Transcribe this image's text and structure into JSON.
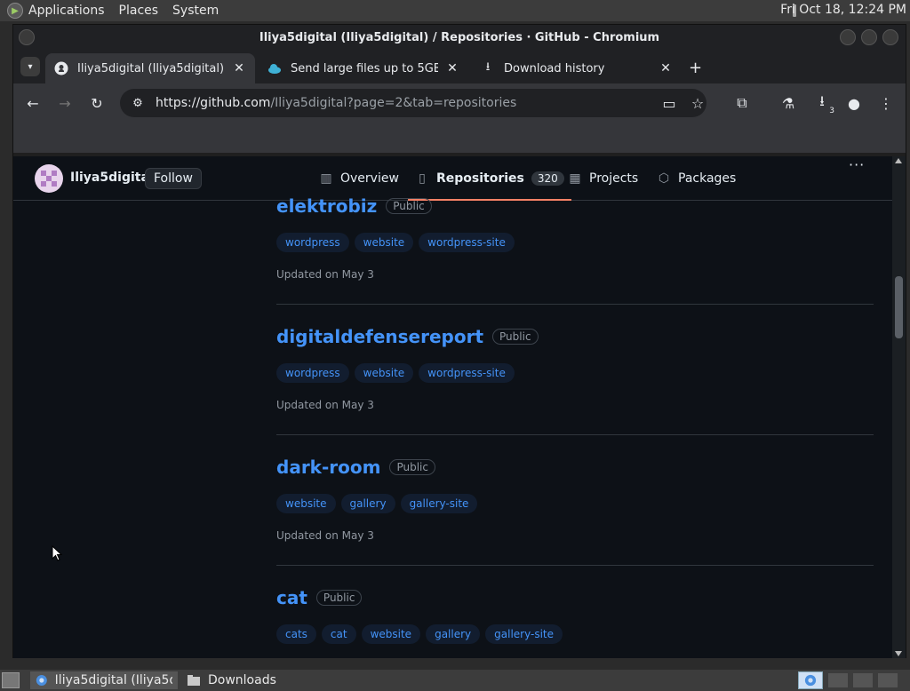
{
  "system_panel": {
    "menus": [
      "Applications",
      "Places",
      "System"
    ],
    "clock": "Fri Oct 18, 12:24 PM"
  },
  "window": {
    "title": "Iliya5digital (Iliya5digital) / Repositories · GitHub - Chromium"
  },
  "tabs": [
    {
      "label": "Iliya5digital (Iliya5digital) / Re",
      "icon": "github-icon",
      "active": true
    },
    {
      "label": "Send large files up to 5GB fo",
      "icon": "cloud-icon",
      "active": false
    },
    {
      "label": "Download history",
      "icon": "download-icon",
      "active": false
    }
  ],
  "toolbar": {
    "url_host": "https://github.com",
    "url_rest": "/Iliya5digital?page=2&tab=repositories",
    "download_count": "3"
  },
  "profile": {
    "username": "Iliya5digital",
    "follow_label": "Follow",
    "nav": [
      {
        "label": "Overview",
        "icon": "book-icon"
      },
      {
        "label": "Repositories",
        "icon": "repo-icon",
        "count": "320",
        "selected": true
      },
      {
        "label": "Projects",
        "icon": "table-icon"
      },
      {
        "label": "Packages",
        "icon": "package-icon"
      }
    ],
    "more": "···"
  },
  "repos": [
    {
      "name": "elektrobiz",
      "visibility": "Public",
      "topics": [
        "wordpress",
        "website",
        "wordpress-site"
      ],
      "updated": "Updated on May 3"
    },
    {
      "name": "digitaldefensereport",
      "visibility": "Public",
      "topics": [
        "wordpress",
        "website",
        "wordpress-site"
      ],
      "updated": "Updated on May 3"
    },
    {
      "name": "dark-room",
      "visibility": "Public",
      "topics": [
        "website",
        "gallery",
        "gallery-site"
      ],
      "updated": "Updated on May 3"
    },
    {
      "name": "cat",
      "visibility": "Public",
      "topics": [
        "cats",
        "cat",
        "website",
        "gallery",
        "gallery-site"
      ],
      "updated": ""
    }
  ],
  "taskbar": {
    "tasks": [
      "Iliya5digital (Iliya5di...",
      "Downloads"
    ]
  },
  "colors": {
    "link": "#4493f8",
    "page_bg": "#0d1117",
    "selected_underline": "#f78166"
  }
}
